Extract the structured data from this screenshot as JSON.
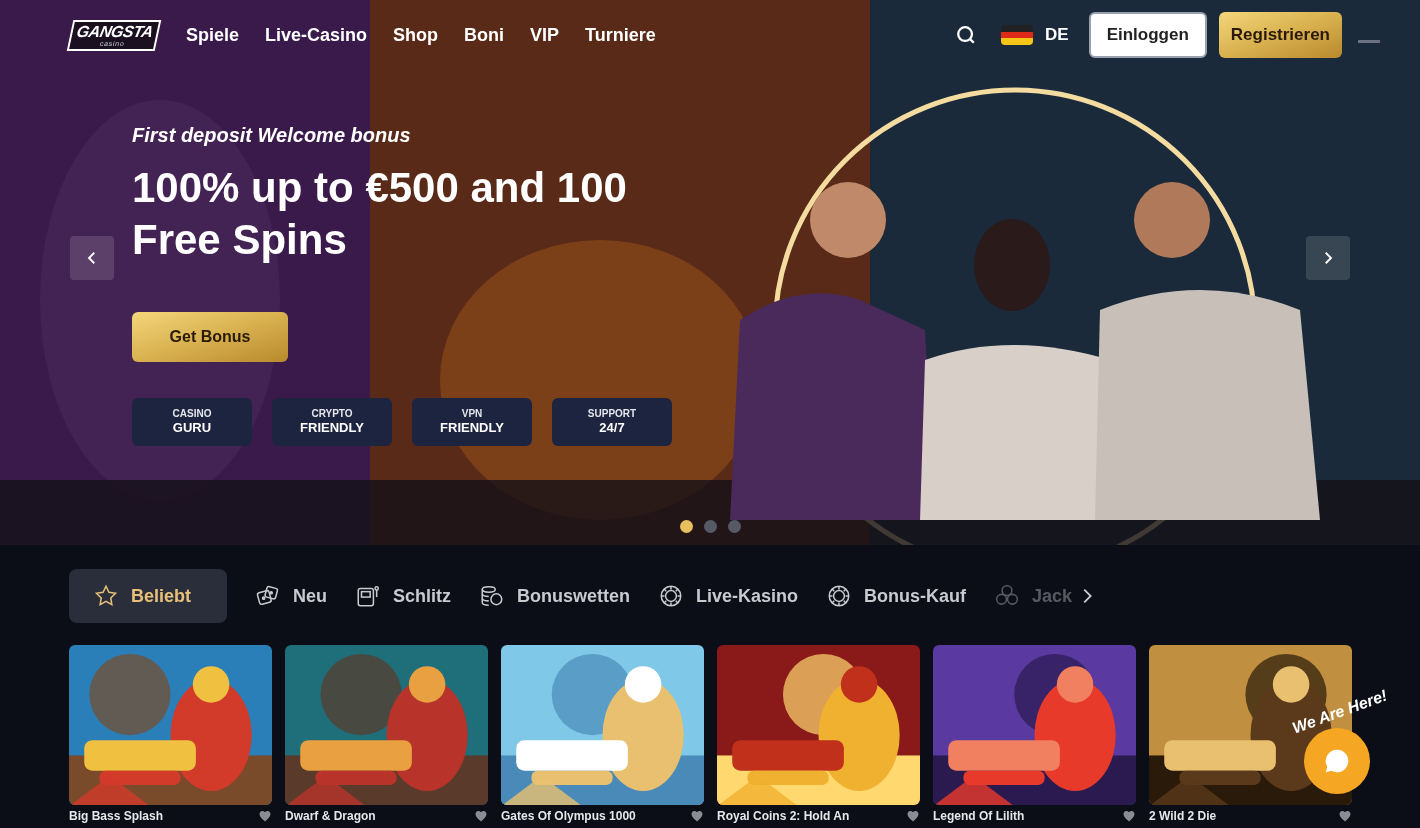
{
  "logo": {
    "name": "GANGSTA",
    "sub": "casino"
  },
  "nav": [
    "Spiele",
    "Live-Casino",
    "Shop",
    "Boni",
    "VIP",
    "Turniere"
  ],
  "language": "DE",
  "login": "Einloggen",
  "register": "Registrieren",
  "hero": {
    "kicker": "First deposit Welcome bonus",
    "headline": "100% up to €500 and 100 Free Spins",
    "cta": "Get Bonus",
    "badges": [
      {
        "lines": [
          "CASINO",
          "GURU"
        ]
      },
      {
        "lines": [
          "CRYPTO",
          "FRIENDLY"
        ]
      },
      {
        "lines": [
          "VPN",
          "FRIENDLY"
        ]
      },
      {
        "lines": [
          "SUPPORT",
          "24/7"
        ]
      }
    ],
    "slides": [
      {
        "selected": true
      },
      {
        "selected": false
      },
      {
        "selected": false
      }
    ]
  },
  "tabs": [
    {
      "label": "Beliebt",
      "kind": "star",
      "selected": true
    },
    {
      "label": "Neu",
      "kind": "dice",
      "selected": false
    },
    {
      "label": "Schlitz",
      "kind": "slot",
      "selected": false
    },
    {
      "label": "Bonuswetten",
      "kind": "coins",
      "selected": false
    },
    {
      "label": "Live-Kasino",
      "kind": "chip",
      "selected": false
    },
    {
      "label": "Bonus-Kauf",
      "kind": "chip",
      "selected": false
    },
    {
      "label": "Jack",
      "kind": "chips",
      "selected": false
    }
  ],
  "games": [
    {
      "title": "Big Bass Splash"
    },
    {
      "title": "Dwarf & Dragon"
    },
    {
      "title": "Gates Of Olympus 1000"
    },
    {
      "title": "Royal Coins 2: Hold An"
    },
    {
      "title": "Legend Of Lilith"
    },
    {
      "title": "2 Wild 2 Die"
    }
  ],
  "chat": {
    "label": "We Are Here!"
  }
}
